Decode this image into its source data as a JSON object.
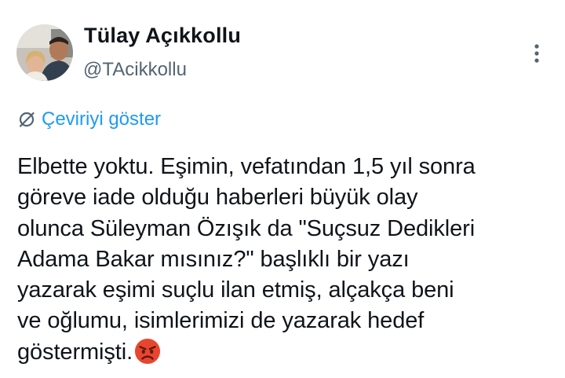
{
  "author": {
    "display_name": "Tülay Açıkkollu",
    "handle": "@TAcikkollu"
  },
  "more_icon": "more-vertical-icon",
  "translate": {
    "icon": "globe-slash-icon",
    "label": "Çeviriyi göster"
  },
  "tweet": {
    "lines": [
      "Elbette yoktu. Eşimin, vefatından 1,5 yıl sonra",
      "göreve iade olduğu haberleri büyük olay",
      "olunca Süleyman Özışık da \"Suçsuz Dedikleri",
      "Adama Bakar mısınız?\" başlıklı bir yazı",
      "yazarak eşimi suçlu ilan etmiş, alçakça beni",
      "ve oğlumu, isimlerimizi de yazarak hedef",
      "göstermişti."
    ],
    "emoji": "angry-face-emoji"
  },
  "colors": {
    "text": "#0f1419",
    "secondary": "#536471",
    "link": "#1d9bf0"
  }
}
